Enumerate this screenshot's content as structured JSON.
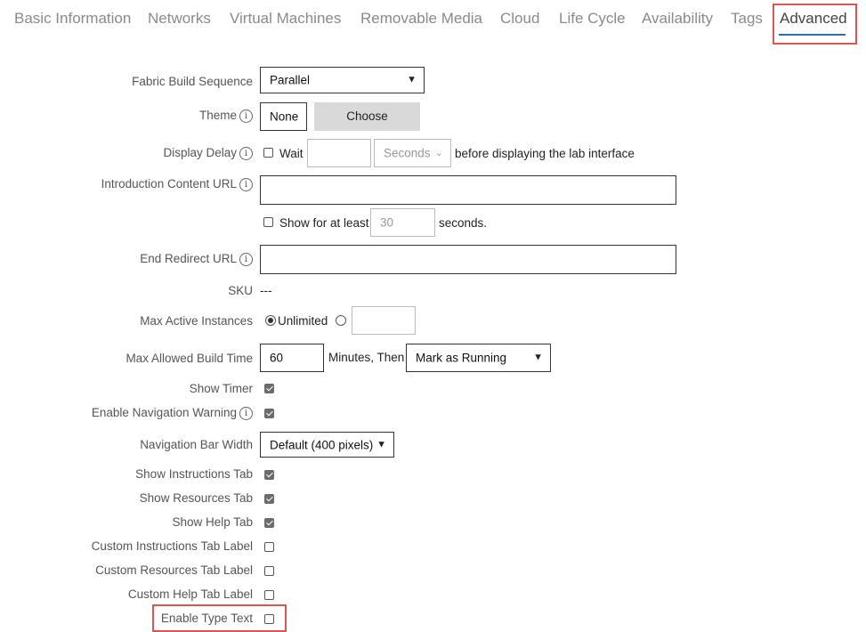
{
  "tabs": [
    {
      "label": "Basic Information"
    },
    {
      "label": "Networks"
    },
    {
      "label": "Virtual Machines"
    },
    {
      "label": "Removable Media"
    },
    {
      "label": "Cloud"
    },
    {
      "label": "Life Cycle"
    },
    {
      "label": "Availability"
    },
    {
      "label": "Tags"
    },
    {
      "label": "Advanced",
      "active": true
    }
  ],
  "form": {
    "fabric_build_sequence": {
      "label": "Fabric Build Sequence",
      "value": "Parallel"
    },
    "theme": {
      "label": "Theme",
      "value": "None",
      "button": "Choose"
    },
    "display_delay": {
      "label": "Display Delay",
      "checkbox_label": "Wait",
      "checked": false,
      "value": "",
      "unit": "Seconds",
      "suffix": "before displaying the lab interface"
    },
    "intro_url": {
      "label": "Introduction Content URL",
      "value": "",
      "show_checkbox_label": "Show for at least",
      "show_checked": false,
      "show_seconds": "30",
      "seconds_suffix": "seconds."
    },
    "end_redirect_url": {
      "label": "End Redirect URL",
      "value": ""
    },
    "sku": {
      "label": "SKU",
      "value": "---"
    },
    "max_active_instances": {
      "label": "Max Active Instances",
      "option_unlimited": "Unlimited",
      "selected": "unlimited",
      "value": ""
    },
    "max_build_time": {
      "label": "Max Allowed Build Time",
      "value": "60",
      "middle_text": "Minutes, Then",
      "action": "Mark as Running"
    },
    "show_timer": {
      "label": "Show Timer",
      "checked": true
    },
    "nav_warning": {
      "label": "Enable Navigation Warning",
      "checked": true
    },
    "nav_bar_width": {
      "label": "Navigation Bar Width",
      "value": "Default (400 pixels)"
    },
    "show_instructions_tab": {
      "label": "Show Instructions Tab",
      "checked": true
    },
    "show_resources_tab": {
      "label": "Show Resources Tab",
      "checked": true
    },
    "show_help_tab": {
      "label": "Show Help Tab",
      "checked": true
    },
    "custom_instructions_label": {
      "label": "Custom Instructions Tab Label",
      "checked": false
    },
    "custom_resources_label": {
      "label": "Custom Resources Tab Label",
      "checked": false
    },
    "custom_help_label": {
      "label": "Custom Help Tab Label",
      "checked": false
    },
    "enable_type_text": {
      "label": "Enable Type Text",
      "checked": false
    }
  },
  "icons": {
    "info": "info-icon",
    "chevron": "chevron-down-icon"
  },
  "colors": {
    "highlight": "#e05353",
    "active_underline": "#2f6db3"
  }
}
